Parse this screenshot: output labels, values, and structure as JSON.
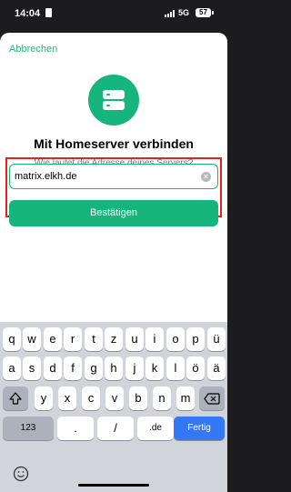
{
  "status_bar": {
    "time": "14:04",
    "network": "5G",
    "battery": "57"
  },
  "sheet": {
    "cancel_label": "Abbrechen",
    "title": "Mit Homeserver verbinden",
    "subtitle": "Wie lautet die Adresse deines Servers?",
    "server_input": {
      "value": "matrix.elkh.de",
      "placeholder": ""
    },
    "confirm_label": "Bestätigen",
    "accent_color": "#16b57d"
  },
  "keyboard": {
    "row1": [
      "q",
      "w",
      "e",
      "r",
      "t",
      "z",
      "u",
      "i",
      "o",
      "p",
      "ü"
    ],
    "row2": [
      "a",
      "s",
      "d",
      "f",
      "g",
      "h",
      "j",
      "k",
      "l",
      "ö",
      "ä"
    ],
    "row3": [
      "y",
      "x",
      "c",
      "v",
      "b",
      "n",
      "m"
    ],
    "numbers_label": "123",
    "dot_label": ".",
    "slash_label": "/",
    "tld_label": ".de",
    "done_label": "Fertig",
    "icons": [
      "shift-icon",
      "backspace-icon",
      "emoji-icon"
    ]
  }
}
